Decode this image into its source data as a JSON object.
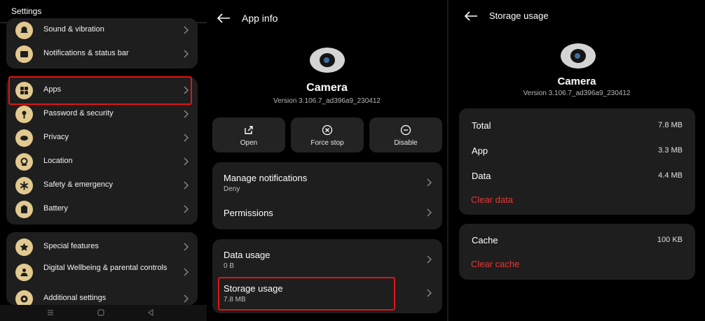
{
  "settings": {
    "title": "Settings",
    "group1": [
      "Sound & vibration",
      "Notifications & status bar"
    ],
    "group2": [
      "Apps",
      "Password & security",
      "Privacy",
      "Location",
      "Safety & emergency",
      "Battery"
    ],
    "group3": [
      "Special features",
      "Digital Wellbeing & parental controls",
      "Additional settings"
    ]
  },
  "app_info": {
    "title": "App info",
    "app_name": "Camera",
    "version": "Version 3.106.7_ad396a9_230412",
    "actions": [
      "Open",
      "Force stop",
      "Disable"
    ],
    "manage_notifications": {
      "label": "Manage notifications",
      "value": "Deny"
    },
    "permissions": "Permissions",
    "data_usage": {
      "label": "Data usage",
      "value": "0 B"
    },
    "storage_usage": {
      "label": "Storage usage",
      "value": "7.8 MB"
    }
  },
  "storage": {
    "title": "Storage usage",
    "app_name": "Camera",
    "version": "Version 3.106.7_ad396a9_230412",
    "total": {
      "label": "Total",
      "value": "7.8 MB"
    },
    "app": {
      "label": "App",
      "value": "3.3 MB"
    },
    "data": {
      "label": "Data",
      "value": "4.4 MB"
    },
    "clear_data": "Clear data",
    "cache": {
      "label": "Cache",
      "value": "100 KB"
    },
    "clear_cache": "Clear cache"
  },
  "colors": {
    "accent_red": "#e53935",
    "highlight": "#e01414",
    "icon_bg": "#e2c98f",
    "card": "#1e1e1e"
  }
}
